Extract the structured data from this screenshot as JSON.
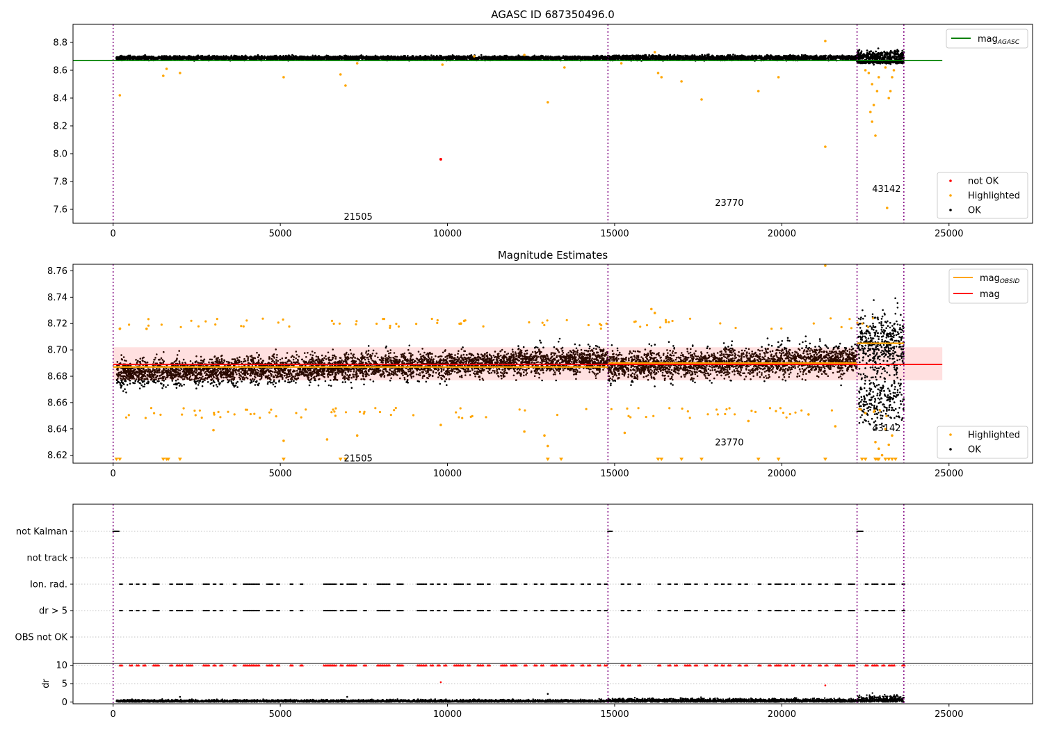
{
  "figure": {
    "obsids": [
      "21505",
      "23770",
      "43142"
    ],
    "obs_boundaries": [
      0,
      14800,
      22250,
      23650
    ],
    "obsid_label_positions": [
      [
        6900,
        7.55
      ],
      [
        18000,
        7.65
      ],
      [
        22700,
        7.75
      ]
    ],
    "obsid_label_positions_mid": [
      [
        6900,
        8.618
      ],
      [
        18000,
        8.63
      ],
      [
        22700,
        8.641
      ]
    ]
  },
  "chart_data": [
    {
      "type": "scatter",
      "title": "AGASC ID 687350496.0",
      "xlim": [
        -1200,
        27500
      ],
      "ylim": [
        7.5,
        8.93
      ],
      "xticks": [
        0,
        5000,
        10000,
        15000,
        20000,
        25000
      ],
      "yticks": [
        7.6,
        7.8,
        8.0,
        8.2,
        8.4,
        8.6,
        8.8
      ],
      "ytick_labels": [
        "7.6",
        "7.8",
        "8.0",
        "8.2",
        "8.4",
        "8.6",
        "8.8"
      ],
      "reference_line": {
        "name": "mag",
        "subscript": "AGASC",
        "value": 8.67,
        "x_range": [
          -1200,
          24800
        ],
        "color": "#008000"
      },
      "segments": [
        {
          "x": [
            100,
            14800
          ],
          "center": 8.688,
          "spread": 0.02
        },
        {
          "x": [
            14800,
            22250
          ],
          "center": 8.69,
          "spread": 0.024
        },
        {
          "x": [
            22250,
            23650
          ],
          "center": 8.7,
          "spread": 0.06
        }
      ],
      "series": [
        {
          "name": "not OK",
          "color": "#ff0000",
          "points": [
            [
              9800,
              7.96
            ]
          ]
        },
        {
          "name": "Highlighted",
          "color": "#ffa500",
          "points": [
            [
              200,
              8.42
            ],
            [
              1500,
              8.56
            ],
            [
              1600,
              8.61
            ],
            [
              2000,
              8.58
            ],
            [
              5100,
              8.55
            ],
            [
              6800,
              8.57
            ],
            [
              6950,
              8.49
            ],
            [
              7300,
              8.65
            ],
            [
              9850,
              8.64
            ],
            [
              10800,
              8.7
            ],
            [
              12300,
              8.71
            ],
            [
              13000,
              8.37
            ],
            [
              13500,
              8.62
            ],
            [
              15200,
              8.65
            ],
            [
              16300,
              8.58
            ],
            [
              16400,
              8.55
            ],
            [
              16200,
              8.73
            ],
            [
              17000,
              8.52
            ],
            [
              17600,
              8.39
            ],
            [
              19300,
              8.45
            ],
            [
              19900,
              8.55
            ],
            [
              21300,
              8.81
            ],
            [
              21300,
              8.05
            ],
            [
              22500,
              8.6
            ],
            [
              22700,
              8.5
            ],
            [
              22750,
              8.35
            ],
            [
              22800,
              8.13
            ],
            [
              22850,
              8.45
            ],
            [
              22900,
              8.55
            ],
            [
              23100,
              8.62
            ],
            [
              23200,
              8.4
            ],
            [
              23250,
              8.45
            ],
            [
              23300,
              8.55
            ],
            [
              23150,
              7.61
            ],
            [
              23350,
              8.6
            ],
            [
              22600,
              8.58
            ],
            [
              22650,
              8.3
            ],
            [
              22700,
              8.23
            ]
          ]
        },
        {
          "name": "OK",
          "color": "#000000",
          "points": []
        }
      ],
      "legends": [
        {
          "position": "top-right",
          "entries": [
            {
              "name": "mag",
              "subscript": "AGASC",
              "color": "#008000",
              "kind": "line"
            }
          ]
        },
        {
          "position": "bottom-right",
          "entries": [
            {
              "name": "not OK",
              "color": "#ff0000",
              "kind": "dot"
            },
            {
              "name": "Highlighted",
              "color": "#ffa500",
              "kind": "dot"
            },
            {
              "name": "OK",
              "color": "#000000",
              "kind": "dot"
            }
          ]
        }
      ]
    },
    {
      "type": "scatter",
      "title": "Magnitude Estimates",
      "xlim": [
        -1200,
        27500
      ],
      "ylim": [
        8.614,
        8.765
      ],
      "xticks": [
        0,
        5000,
        10000,
        15000,
        20000,
        25000
      ],
      "yticks": [
        8.62,
        8.64,
        8.66,
        8.68,
        8.7,
        8.72,
        8.74,
        8.76
      ],
      "ytick_labels": [
        "8.62",
        "8.64",
        "8.66",
        "8.68",
        "8.70",
        "8.72",
        "8.74",
        "8.76"
      ],
      "mag_line": {
        "name": "mag",
        "value": 8.689,
        "band": [
          8.677,
          8.702
        ],
        "x_range": [
          0,
          24800
        ],
        "color": "#ff0000"
      },
      "obsid_mag": [
        {
          "x": [
            0,
            14800
          ],
          "value": 8.687
        },
        {
          "x": [
            14800,
            22250
          ],
          "value": 8.69
        },
        {
          "x": [
            22250,
            23650
          ],
          "value": 8.705
        }
      ],
      "segments": [
        {
          "x": [
            100,
            14800
          ],
          "center": 8.687,
          "spread": 0.009
        },
        {
          "x": [
            14800,
            22250
          ],
          "center": 8.69,
          "spread": 0.01
        },
        {
          "x": [
            22250,
            23650
          ],
          "center": 8.705,
          "spread": 0.02
        }
      ],
      "triangles_x": [
        100,
        200,
        1500,
        1600,
        1650,
        2000,
        5100,
        6800,
        6950,
        13000,
        13400,
        16300,
        16400,
        17000,
        17600,
        19300,
        19900,
        21300,
        22400,
        22500,
        22800,
        22850,
        22900,
        23100,
        23200,
        23300,
        23400
      ],
      "series": [
        {
          "name": "Highlighted",
          "color": "#ffa500",
          "points": [
            [
              200,
              8.716
            ],
            [
              1000,
              8.716
            ],
            [
              3000,
              8.639
            ],
            [
              5100,
              8.631
            ],
            [
              6400,
              8.632
            ],
            [
              7300,
              8.635
            ],
            [
              9800,
              8.643
            ],
            [
              10400,
              8.72
            ],
            [
              10500,
              8.722
            ],
            [
              12300,
              8.638
            ],
            [
              12900,
              8.635
            ],
            [
              13000,
              8.627
            ],
            [
              15300,
              8.637
            ],
            [
              16100,
              8.731
            ],
            [
              16200,
              8.728
            ],
            [
              19000,
              8.646
            ],
            [
              20800,
              8.651
            ],
            [
              21300,
              8.764
            ],
            [
              21600,
              8.642
            ],
            [
              22500,
              8.652
            ],
            [
              22800,
              8.63
            ],
            [
              22900,
              8.625
            ],
            [
              23000,
              8.62
            ],
            [
              23100,
              8.64
            ],
            [
              23200,
              8.628
            ],
            [
              23300,
              8.635
            ]
          ]
        },
        {
          "name": "OK",
          "color": "#000000",
          "points": []
        }
      ],
      "legends": [
        {
          "position": "top-right",
          "entries": [
            {
              "name": "mag",
              "subscript": "OBSID",
              "color": "#ffa500",
              "kind": "line"
            },
            {
              "name": "mag",
              "color": "#ff0000",
              "kind": "line"
            }
          ]
        },
        {
          "position": "bottom-right",
          "entries": [
            {
              "name": "Highlighted",
              "color": "#ffa500",
              "kind": "dot"
            },
            {
              "name": "OK",
              "color": "#000000",
              "kind": "dot"
            }
          ]
        }
      ]
    },
    {
      "type": "scatter",
      "xlim": [
        -1200,
        27500
      ],
      "categories": [
        "not Kalman",
        "not track",
        "Ion. rad.",
        "dr > 5",
        "OBS not OK"
      ],
      "flag_events": {
        "not Kalman": [
          0,
          50,
          100,
          14800,
          14850,
          22250,
          22300,
          22350
        ],
        "not track": [],
        "Ion. rad.": [
          200,
          500,
          700,
          900,
          1200,
          1300,
          1700,
          1900,
          2000,
          2200,
          2300,
          2700,
          2800,
          3000,
          3200,
          3600,
          3900,
          4000,
          4100,
          4200,
          4300,
          4600,
          4700,
          4900,
          5300,
          5600,
          6300,
          6400,
          6500,
          6600,
          6800,
          7000,
          7100,
          7200,
          7500,
          7900,
          8000,
          8100,
          8200,
          8500,
          8600,
          9100,
          9200,
          9300,
          9500,
          9700,
          9900,
          10200,
          10300,
          10400,
          10600,
          10900,
          11000,
          11200,
          11600,
          11700,
          11900,
          12000,
          12300,
          12600,
          12800,
          13100,
          13200,
          13400,
          13500,
          13700,
          14000,
          14200,
          14500,
          14700,
          15200,
          15400,
          15700,
          16300,
          16600,
          16800,
          17100,
          17200,
          17400,
          17700,
          18000,
          18200,
          18400,
          18700,
          18900,
          19300,
          19600,
          19800,
          19900,
          20100,
          20300,
          20600,
          20800,
          21100,
          21300,
          21600,
          21700,
          22000,
          22100,
          22500,
          22700,
          22800,
          23000,
          23200,
          23300,
          23600
        ],
        "dr > 5": [
          200,
          500,
          700,
          900,
          1200,
          1300,
          1700,
          1900,
          2000,
          2200,
          2300,
          2700,
          2800,
          3000,
          3200,
          3600,
          3900,
          4000,
          4100,
          4200,
          4300,
          4600,
          4700,
          4900,
          5300,
          5600,
          6300,
          6400,
          6500,
          6600,
          6800,
          7000,
          7100,
          7200,
          7500,
          7900,
          8000,
          8100,
          8200,
          8500,
          8600,
          9100,
          9200,
          9300,
          9500,
          9700,
          9900,
          10200,
          10300,
          10400,
          10600,
          10900,
          11000,
          11200,
          11600,
          11700,
          11900,
          12000,
          12300,
          12600,
          12800,
          13100,
          13200,
          13400,
          13500,
          13700,
          14000,
          14200,
          14500,
          14700,
          15200,
          15400,
          15700,
          16300,
          16600,
          16800,
          17100,
          17200,
          17400,
          17700,
          18000,
          18200,
          18400,
          18700,
          18900,
          19300,
          19600,
          19800,
          19900,
          20100,
          20300,
          20600,
          20800,
          21100,
          21300,
          21600,
          21700,
          22000,
          22100,
          22500,
          22700,
          22800,
          23000,
          23200,
          23300,
          23600
        ],
        "OBS not OK": []
      }
    },
    {
      "type": "scatter",
      "xlim": [
        -1200,
        27500
      ],
      "ylim": [
        -0.5,
        10.5
      ],
      "xticks": [
        0,
        5000,
        10000,
        15000,
        20000,
        25000
      ],
      "yticks": [
        0,
        5,
        10
      ],
      "ytick_labels": [
        "0",
        "5",
        "10"
      ],
      "ylabel": "dr",
      "capped_value": 10,
      "outliers": [
        [
          9800,
          5.4
        ],
        [
          21300,
          4.5
        ],
        [
          13000,
          2.2
        ],
        [
          7000,
          1.4
        ],
        [
          2000,
          1.4
        ]
      ]
    }
  ]
}
